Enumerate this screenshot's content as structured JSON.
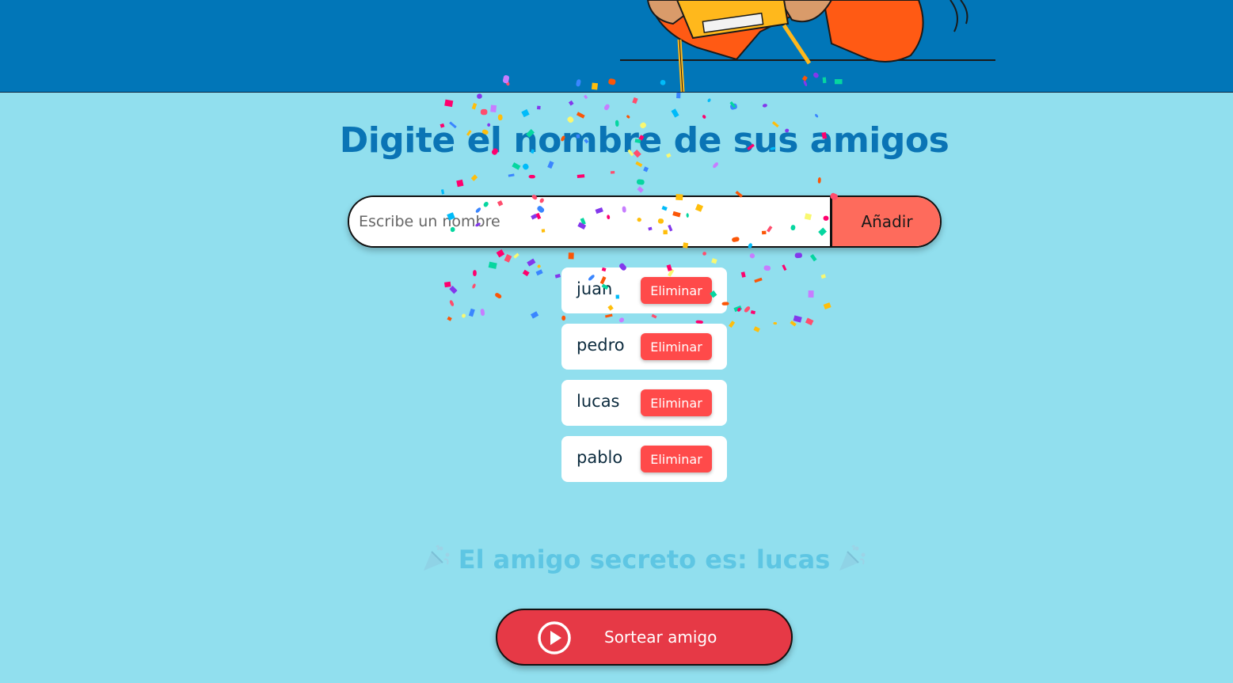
{
  "header": {
    "background_color": "#0176b8",
    "illustration": "person-holding-gift-box"
  },
  "main": {
    "title": "Digite el nombre de sus amigos",
    "input": {
      "placeholder": "Escribe un nombre",
      "value": ""
    },
    "add_button_label": "Añadir"
  },
  "friends": [
    {
      "name": "juan",
      "remove_label": "Eliminar"
    },
    {
      "name": "pedro",
      "remove_label": "Eliminar"
    },
    {
      "name": "lucas",
      "remove_label": "Eliminar"
    },
    {
      "name": "pablo",
      "remove_label": "Eliminar"
    }
  ],
  "result": {
    "text": "El amigo secreto es: lucas",
    "icon": "party-popper-icon"
  },
  "draw_button": {
    "label": "Sortear amigo",
    "icon": "play-circle-icon"
  },
  "colors": {
    "accent": "#e63946",
    "add_button": "#fe6b5c",
    "remove_button": "#ff4a4a",
    "title": "#0a74b5",
    "page_background": "#91dfee"
  }
}
